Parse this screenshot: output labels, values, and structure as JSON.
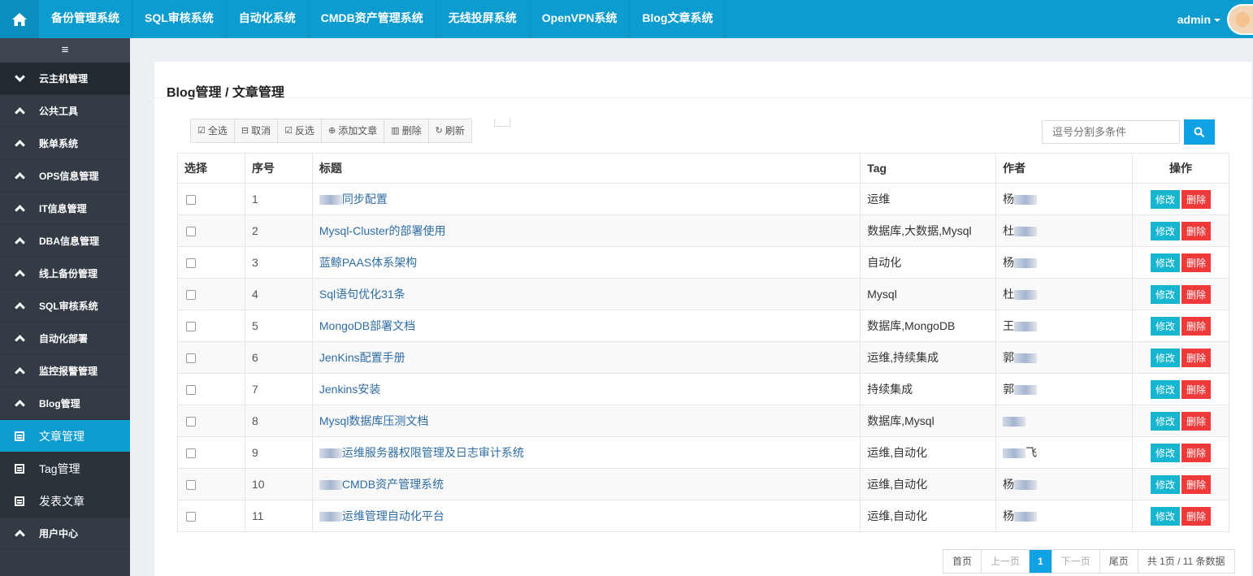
{
  "topnav": {
    "items": [
      "备份管理系统",
      "SQL审核系统",
      "自动化系统",
      "CMDB资产管理系统",
      "无线投屏系统",
      "OpenVPN系统",
      "Blog文章系统"
    ],
    "user": "admin"
  },
  "sidebar": {
    "toggle": "≡",
    "items": [
      {
        "label": "云主机管理"
      },
      {
        "label": "公共工具"
      },
      {
        "label": "账单系统"
      },
      {
        "label": "OPS信息管理"
      },
      {
        "label": "IT信息管理"
      },
      {
        "label": "DBA信息管理"
      },
      {
        "label": "线上备份管理"
      },
      {
        "label": "SQL审核系统"
      },
      {
        "label": "自动化部署"
      },
      {
        "label": "监控报警管理"
      },
      {
        "label": "Blog管理"
      },
      {
        "label": "文章管理"
      },
      {
        "label": "Tag管理"
      },
      {
        "label": "发表文章"
      },
      {
        "label": "用户中心"
      }
    ]
  },
  "page": {
    "title": "Blog管理 / 文章管理"
  },
  "toolbar": {
    "select_all": "全选",
    "cancel": "取消",
    "invert": "反选",
    "add": "添加文章",
    "delete": "删除",
    "refresh": "刷新"
  },
  "search": {
    "placeholder": "逗号分割多条件"
  },
  "table": {
    "headers": [
      "选择",
      "序号",
      "标题",
      "Tag",
      "作者",
      "操作"
    ],
    "edit_label": "修改",
    "delete_label": "删除",
    "rows": [
      {
        "id": "1",
        "title": "同步配置",
        "tag": "运维",
        "author": "杨"
      },
      {
        "id": "2",
        "title": "Mysql-Cluster的部署使用",
        "tag": "数据库,大数据,Mysql",
        "author": "杜"
      },
      {
        "id": "3",
        "title": "蓝鲸PAAS体系架构",
        "tag": "自动化",
        "author": "杨"
      },
      {
        "id": "4",
        "title": "Sql语句优化31条",
        "tag": "Mysql",
        "author": "杜"
      },
      {
        "id": "5",
        "title": "MongoDB部署文档",
        "tag": "数据库,MongoDB",
        "author": "王"
      },
      {
        "id": "6",
        "title": "JenKins配置手册",
        "tag": "运维,持续集成",
        "author": "郭"
      },
      {
        "id": "7",
        "title": "Jenkins安装",
        "tag": "持续集成",
        "author": "郭"
      },
      {
        "id": "8",
        "title": "Mysql数据库压测文档",
        "tag": "数据库,Mysql",
        "author": ""
      },
      {
        "id": "9",
        "title": "运维服务器权限管理及日志审计系统",
        "tag": "运维,自动化",
        "author": "飞"
      },
      {
        "id": "10",
        "title": "CMDB资产管理系统",
        "tag": "运维,自动化",
        "author": "杨"
      },
      {
        "id": "11",
        "title": "运维管理自动化平台",
        "tag": "运维,自动化",
        "author": "杨"
      }
    ]
  },
  "pager": {
    "first": "首页",
    "prev": "上一页",
    "current": "1",
    "next": "下一页",
    "last": "尾页",
    "summary": "共 1页 / 11 条数据"
  }
}
